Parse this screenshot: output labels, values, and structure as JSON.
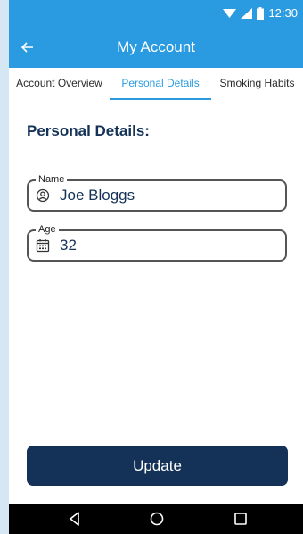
{
  "status_bar": {
    "time": "12:30",
    "icons": [
      "wifi-icon",
      "signal-icon",
      "battery-icon"
    ]
  },
  "app_bar": {
    "title": "My Account",
    "back_icon": "back-arrow-icon"
  },
  "tabs": [
    {
      "label": "Account Overview",
      "active": false
    },
    {
      "label": "Personal Details",
      "active": true
    },
    {
      "label": "Smoking Habits",
      "active": false
    }
  ],
  "section": {
    "title": "Personal Details:"
  },
  "fields": {
    "name": {
      "label": "Name",
      "value": "Joe Bloggs",
      "icon": "user-circle-icon"
    },
    "age": {
      "label": "Age",
      "value": "32",
      "icon": "calendar-icon"
    }
  },
  "update_button": {
    "label": "Update"
  },
  "nav_bar": {
    "buttons": [
      "nav-back-icon",
      "nav-home-icon",
      "nav-recent-icon"
    ]
  },
  "colors": {
    "primary": "#2a9be0",
    "navy": "#143258",
    "page_edge": "#d4e7f3"
  }
}
